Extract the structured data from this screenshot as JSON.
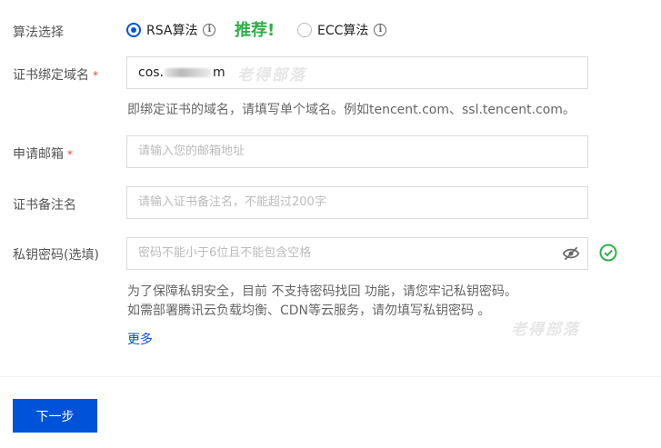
{
  "form": {
    "algorithm": {
      "label": "算法选择",
      "options": [
        {
          "label": "RSA算法",
          "selected": true
        },
        {
          "label": "ECC算法",
          "selected": false
        }
      ],
      "recommend_text": "推荐!"
    },
    "domain": {
      "label": "证书绑定域名",
      "required_mark": "*",
      "value_prefix": "cos.",
      "value_suffix": "m",
      "help": "即绑定证书的域名，请填写单个域名。例如tencent.com、ssl.tencent.com。"
    },
    "email": {
      "label": "申请邮箱",
      "required_mark": "*",
      "placeholder": "请输入您的邮箱地址"
    },
    "remark": {
      "label": "证书备注名",
      "placeholder": "请输入证书备注名，不能超过200字"
    },
    "private_key": {
      "label": "私钥密码(选填)",
      "placeholder": "密码不能小于6位且不能包含空格",
      "help_line1": "为了保障私钥安全，目前 不支持密码找回 功能，请您牢记私钥密码。",
      "help_line2": "如需部署腾讯云负载均衡、CDN等云服务，请勿填写私钥密码 。"
    },
    "more_link": "更多"
  },
  "watermark": "老得部落",
  "footer": {
    "next_button": "下一步"
  },
  "colors": {
    "primary": "#0052d9",
    "recommend": "#2eb04a",
    "required": "#e54545",
    "success": "#2eb04a"
  }
}
